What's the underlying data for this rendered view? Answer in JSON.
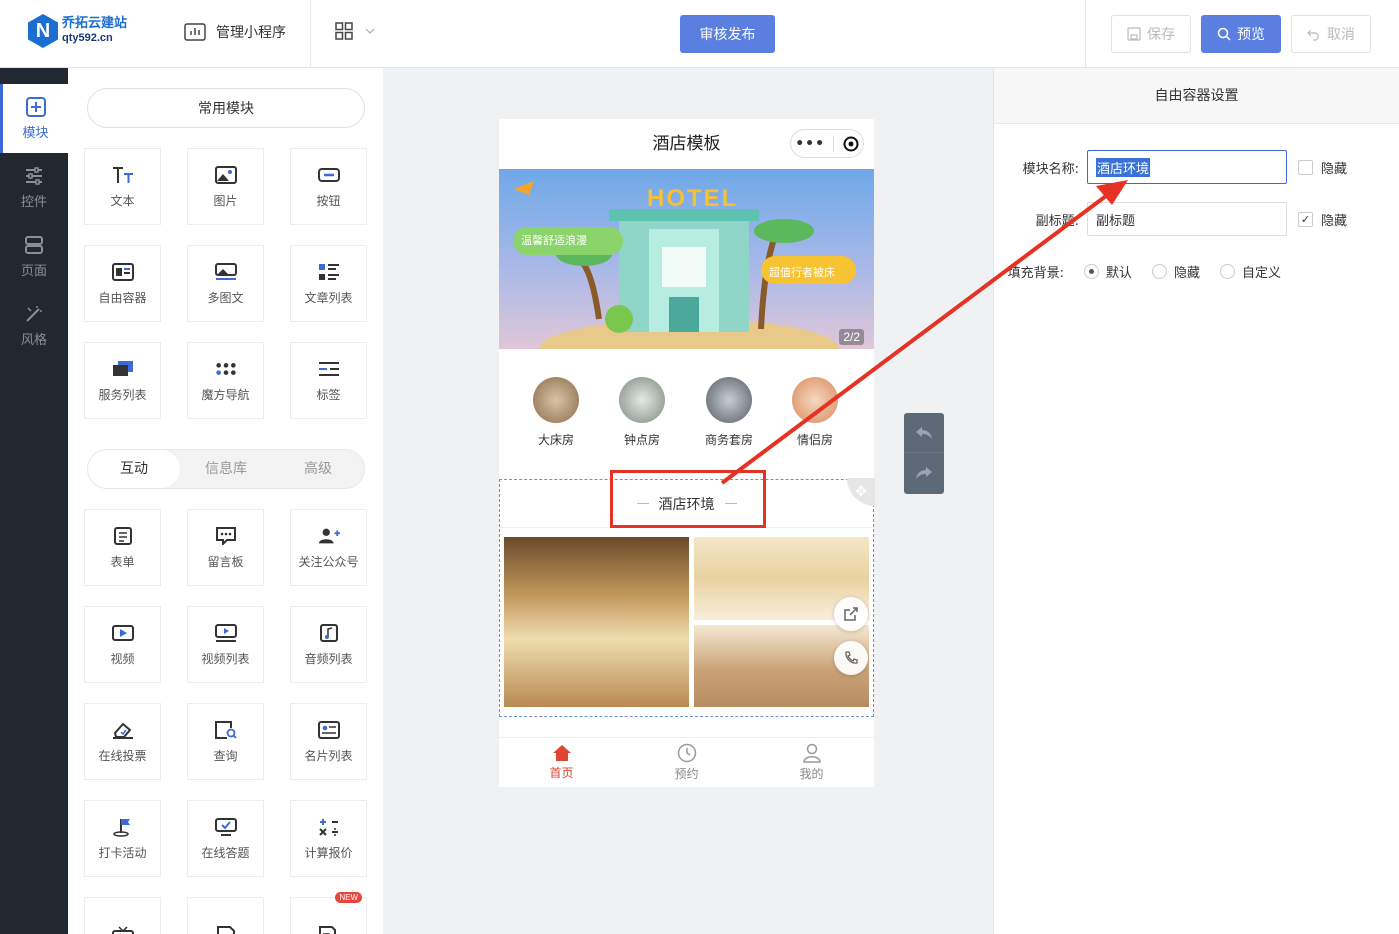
{
  "header": {
    "logo_name": "乔拓云建站",
    "logo_domain": "qty592.cn",
    "manage_label": "管理小程序",
    "publish_label": "审核发布",
    "save_label": "保存",
    "preview_label": "预览",
    "cancel_label": "取消"
  },
  "leftnav": [
    {
      "label": "模块",
      "icon": "plus-square-icon",
      "active": true
    },
    {
      "label": "控件",
      "icon": "sliders-icon"
    },
    {
      "label": "页面",
      "icon": "pages-icon"
    },
    {
      "label": "风格",
      "icon": "magic-wand-icon"
    }
  ],
  "panel": {
    "common_label": "常用模块",
    "common_modules": [
      {
        "label": "文本",
        "icon": "text-icon"
      },
      {
        "label": "图片",
        "icon": "image-icon"
      },
      {
        "label": "按钮",
        "icon": "button-icon"
      },
      {
        "label": "自由容器",
        "icon": "container-icon"
      },
      {
        "label": "多图文",
        "icon": "multi-image-icon"
      },
      {
        "label": "文章列表",
        "icon": "article-list-icon"
      },
      {
        "label": "服务列表",
        "icon": "service-list-icon"
      },
      {
        "label": "魔方导航",
        "icon": "cube-nav-icon"
      },
      {
        "label": "标签",
        "icon": "tag-icon"
      }
    ],
    "tabs": [
      {
        "label": "互动",
        "active": true
      },
      {
        "label": "信息库"
      },
      {
        "label": "高级"
      }
    ],
    "interactive_modules": [
      {
        "label": "表单",
        "icon": "form-icon"
      },
      {
        "label": "留言板",
        "icon": "message-board-icon"
      },
      {
        "label": "关注公众号",
        "icon": "follow-account-icon"
      },
      {
        "label": "视频",
        "icon": "video-icon"
      },
      {
        "label": "视频列表",
        "icon": "video-list-icon"
      },
      {
        "label": "音频列表",
        "icon": "audio-list-icon"
      },
      {
        "label": "在线投票",
        "icon": "vote-icon"
      },
      {
        "label": "查询",
        "icon": "query-icon"
      },
      {
        "label": "名片列表",
        "icon": "card-list-icon"
      },
      {
        "label": "打卡活动",
        "icon": "checkin-icon"
      },
      {
        "label": "在线答题",
        "icon": "quiz-icon"
      },
      {
        "label": "计算报价",
        "icon": "calculator-icon"
      },
      {
        "label": "",
        "icon": "tv-icon"
      },
      {
        "label": "",
        "icon": "doc-list-icon"
      },
      {
        "label": "",
        "icon": "doc-video-icon",
        "badge": "NEW"
      }
    ]
  },
  "phone": {
    "title": "酒店模板",
    "banner_text": "HOTEL",
    "banner_slogan_left": "温馨舒适浪漫",
    "banner_slogan_right": "超值行者被床",
    "banner_counter": "2/2",
    "categories": [
      "大床房",
      "钟点房",
      "商务套房",
      "情侣房"
    ],
    "section_title": "酒店环境",
    "tabbar": [
      {
        "label": "首页",
        "icon": "home-icon",
        "active": true
      },
      {
        "label": "预约",
        "icon": "clock-icon"
      },
      {
        "label": "我的",
        "icon": "user-icon"
      }
    ]
  },
  "settings": {
    "title": "自由容器设置",
    "name_label": "模块名称:",
    "name_value": "酒店环境",
    "name_hide_label": "隐藏",
    "name_hidden": false,
    "subtitle_label": "副标题:",
    "subtitle_value": "副标题",
    "subtitle_hide_label": "隐藏",
    "subtitle_hidden": true,
    "bg_label": "填充背景:",
    "bg_options": [
      "默认",
      "隐藏",
      "自定义"
    ],
    "bg_selected": "默认"
  },
  "colors": {
    "accent": "#5b7fe0",
    "annotation": "#e53225",
    "nav_bg": "#23272f"
  }
}
